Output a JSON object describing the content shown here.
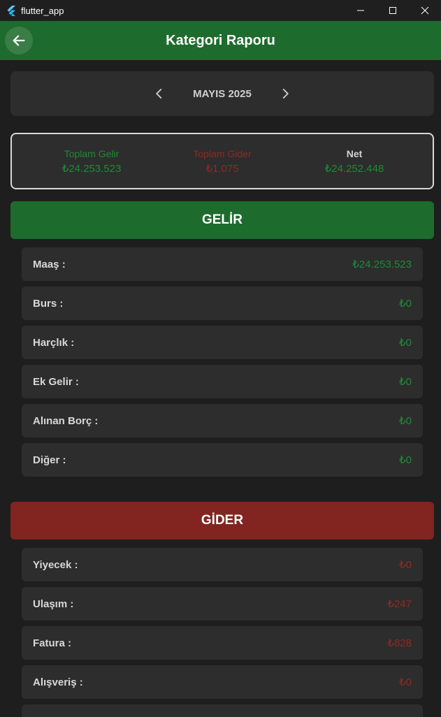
{
  "window": {
    "title": "flutter_app"
  },
  "appbar": {
    "title": "Kategori Raporu"
  },
  "month": {
    "label": "MAYIS 2025"
  },
  "summary": {
    "income": {
      "label": "Toplam Gelir",
      "value": "₺24.253.523"
    },
    "expense": {
      "label": "Toplam Gider",
      "value": "₺1.075"
    },
    "net": {
      "label": "Net",
      "value": "₺24.252.448"
    }
  },
  "income": {
    "title": "GELİR",
    "items": [
      {
        "name": "Maaş :",
        "amount": "₺24.253.523"
      },
      {
        "name": "Burs :",
        "amount": "₺0"
      },
      {
        "name": "Harçlık :",
        "amount": "₺0"
      },
      {
        "name": "Ek Gelir :",
        "amount": "₺0"
      },
      {
        "name": "Alınan Borç :",
        "amount": "₺0"
      },
      {
        "name": "Diğer :",
        "amount": "₺0"
      }
    ]
  },
  "expense": {
    "title": "GİDER",
    "items": [
      {
        "name": "Yiyecek :",
        "amount": "₺0"
      },
      {
        "name": "Ulaşım :",
        "amount": "₺247"
      },
      {
        "name": "Fatura :",
        "amount": "₺828"
      },
      {
        "name": "Alışveriş :",
        "amount": "₺0"
      }
    ]
  },
  "colors": {
    "income": "#1e6b2e",
    "expense": "#822420",
    "background": "#1e1e1e"
  },
  "icons": {
    "back": "arrow-left-icon",
    "prev": "chevron-left-icon",
    "next": "chevron-right-icon"
  }
}
